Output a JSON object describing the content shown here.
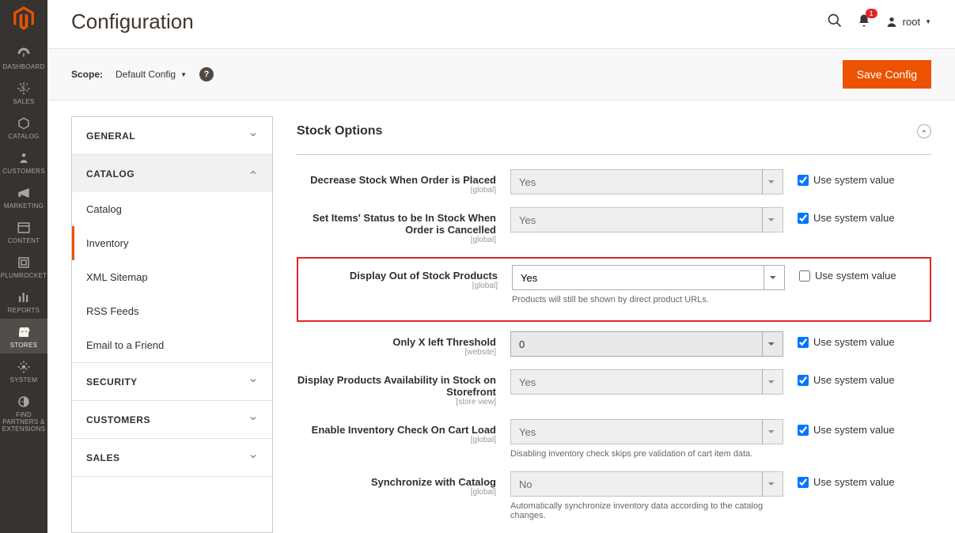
{
  "page": {
    "title": "Configuration"
  },
  "user": {
    "name": "root"
  },
  "notifications": {
    "count": "1"
  },
  "scope": {
    "label": "Scope:",
    "value": "Default Config"
  },
  "buttons": {
    "save": "Save Config"
  },
  "nav": [
    {
      "name": "dashboard",
      "label": "DASHBOARD"
    },
    {
      "name": "sales",
      "label": "SALES"
    },
    {
      "name": "catalog",
      "label": "CATALOG"
    },
    {
      "name": "customers",
      "label": "CUSTOMERS"
    },
    {
      "name": "marketing",
      "label": "MARKETING"
    },
    {
      "name": "content",
      "label": "CONTENT"
    },
    {
      "name": "plumrocket",
      "label": "PLUMROCKET"
    },
    {
      "name": "reports",
      "label": "REPORTS"
    },
    {
      "name": "stores",
      "label": "STORES"
    },
    {
      "name": "system",
      "label": "SYSTEM"
    },
    {
      "name": "find-partners",
      "label": "FIND PARTNERS & EXTENSIONS"
    }
  ],
  "config_sidebar": {
    "sections": [
      {
        "label": "GENERAL",
        "expanded": false
      },
      {
        "label": "CATALOG",
        "expanded": true,
        "items": [
          "Catalog",
          "Inventory",
          "XML Sitemap",
          "RSS Feeds",
          "Email to a Friend"
        ],
        "active": "Inventory"
      },
      {
        "label": "SECURITY",
        "expanded": false
      },
      {
        "label": "CUSTOMERS",
        "expanded": false
      },
      {
        "label": "SALES",
        "expanded": false
      }
    ]
  },
  "section_title": "Stock Options",
  "checkbox_label": "Use system value",
  "fields": {
    "decrease_stock": {
      "label": "Decrease Stock When Order is Placed",
      "scope": "[global]",
      "value": "Yes",
      "disabled": true,
      "checked": true
    },
    "set_instock": {
      "label": "Set Items' Status to be In Stock When Order is Cancelled",
      "scope": "[global]",
      "value": "Yes",
      "disabled": true,
      "checked": true
    },
    "display_oos": {
      "label": "Display Out of Stock Products",
      "scope": "[global]",
      "value": "Yes",
      "disabled": false,
      "checked": false,
      "help": "Products will still be shown by direct product URLs."
    },
    "only_x": {
      "label": "Only X left Threshold",
      "scope": "[website]",
      "value": "0",
      "disabled": true,
      "checked": true
    },
    "display_avail": {
      "label": "Display Products Availability in Stock on Storefront",
      "scope": "[store view]",
      "value": "Yes",
      "disabled": true,
      "checked": true
    },
    "inv_check": {
      "label": "Enable Inventory Check On Cart Load",
      "scope": "[global]",
      "value": "Yes",
      "disabled": true,
      "checked": true,
      "help": "Disabling inventory check skips pre validation of cart item data."
    },
    "sync_catalog": {
      "label": "Synchronize with Catalog",
      "scope": "[global]",
      "value": "No",
      "disabled": true,
      "checked": true,
      "help": "Automatically synchronize inventory data according to the catalog changes."
    }
  }
}
